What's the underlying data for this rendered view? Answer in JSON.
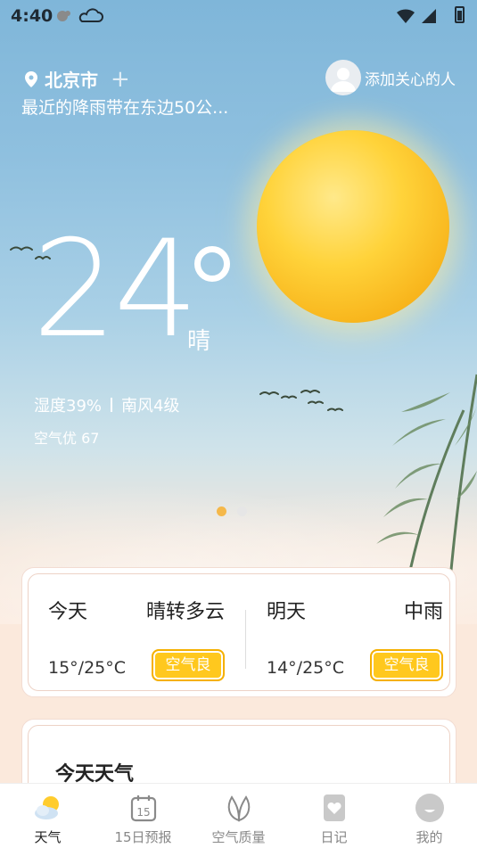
{
  "status_bar": {
    "time": "4:40"
  },
  "header": {
    "city": "北京市",
    "add_city_symbol": "+",
    "rain_notice": "最近的降雨带在东边50公...",
    "care_label": "添加关心的人"
  },
  "current": {
    "temperature": "24",
    "condition": "晴",
    "humidity": "湿度39%",
    "wind": "南风4级",
    "air_quality": "空气优 67"
  },
  "pager": {
    "active_index": 0,
    "count": 2,
    "active_color": "#f5b84a",
    "inactive_color": "#e6e6e6"
  },
  "forecast": {
    "today": {
      "day": "今天",
      "condition": "晴转多云",
      "range": "15°/25°C",
      "aqi_badge": "空气良"
    },
    "tomorrow": {
      "day": "明天",
      "condition": "中雨",
      "range": "14°/25°C",
      "aqi_badge": "空气良"
    }
  },
  "today_card": {
    "title": "今天天气"
  },
  "nav": {
    "items": [
      {
        "label": "天气",
        "icon": "partly-sunny-icon",
        "active": true
      },
      {
        "label": "15日预报",
        "icon": "calendar-15-icon",
        "active": false
      },
      {
        "label": "空气质量",
        "icon": "leaf-icon",
        "active": false
      },
      {
        "label": "日记",
        "icon": "diary-heart-icon",
        "active": false
      },
      {
        "label": "我的",
        "icon": "profile-face-icon",
        "active": false
      }
    ]
  }
}
